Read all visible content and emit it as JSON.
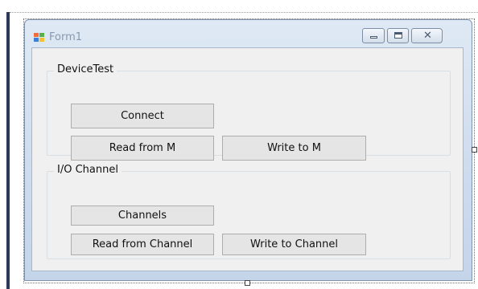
{
  "window": {
    "title": "Form1",
    "icon": "windows-form-icon"
  },
  "caption_buttons": {
    "minimize": "minimize-icon",
    "maximize": "maximize-icon",
    "close": "close-icon"
  },
  "groups": [
    {
      "title": "DeviceTest",
      "buttons": [
        "Connect",
        "Read from M",
        "Write to M"
      ]
    },
    {
      "title": "I/O Channel",
      "buttons": [
        "Channels",
        "Read from Channel",
        "Write to Channel"
      ]
    }
  ]
}
